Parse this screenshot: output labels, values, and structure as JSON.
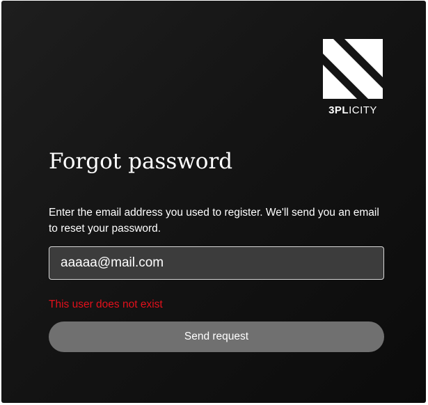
{
  "brand": {
    "logo_icon": "3plicity-logo-mark",
    "name_bold": "3PL",
    "name_light": "ICITY"
  },
  "form": {
    "title": "Forgot password",
    "instructions": "Enter the email address you used to register. We'll send you an email to reset your password.",
    "email_value": "aaaaa@mail.com",
    "error_message": "This user does not exist",
    "submit_label": "Send request"
  },
  "colors": {
    "background": "#141414",
    "input_background": "#3c3c3c",
    "error": "#e3101b",
    "button": "#707070",
    "text": "#ffffff"
  }
}
